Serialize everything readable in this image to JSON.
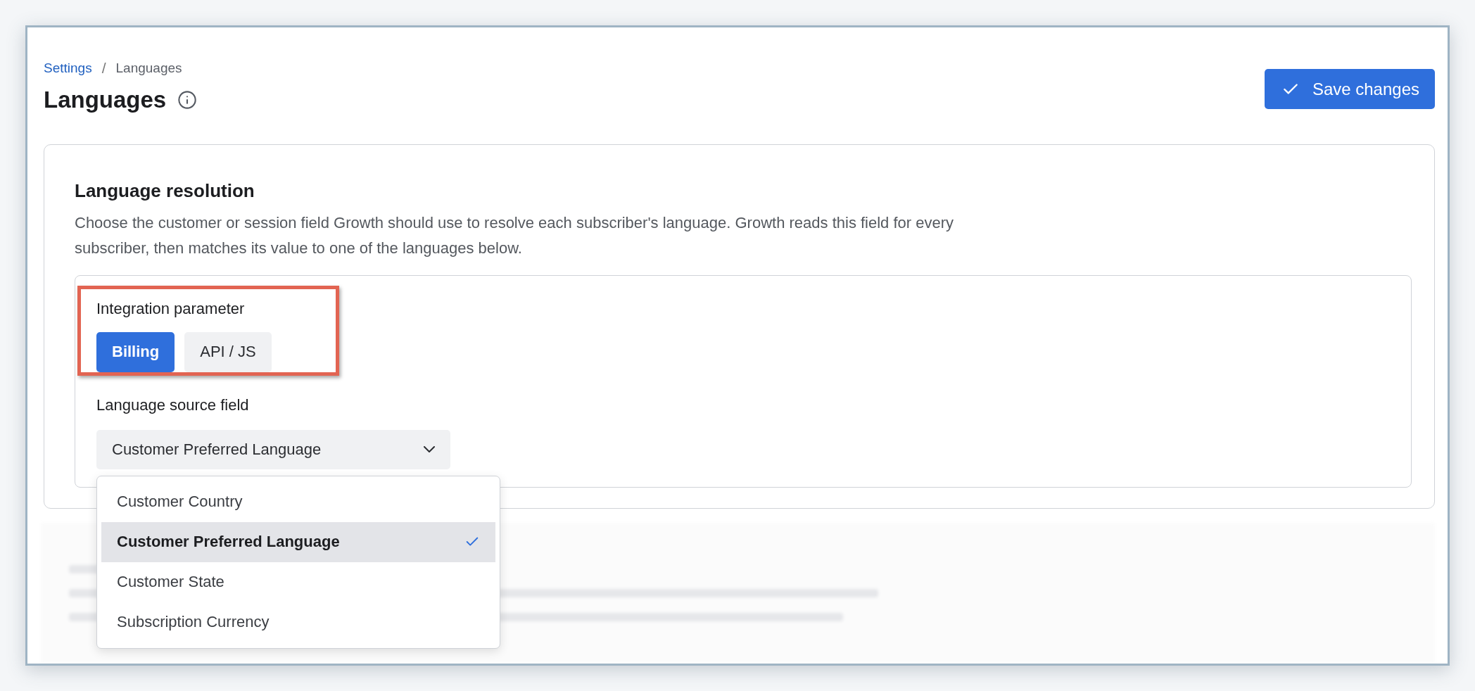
{
  "breadcrumb": {
    "items": [
      {
        "label": "Settings",
        "kind": "link"
      },
      {
        "label": "Languages",
        "kind": "current"
      }
    ],
    "separator": "/"
  },
  "title": "Languages",
  "save_button": {
    "label": "Save changes"
  },
  "section": {
    "title": "Language resolution",
    "description": "Choose the customer or session field Growth should use to resolve each subscriber's language. Growth reads this field for every subscriber, then matches its value to one of the languages below.",
    "integration_parameter": {
      "label": "Integration parameter",
      "options": [
        {
          "label": "Billing",
          "selected": true
        },
        {
          "label": "API / JS",
          "selected": false
        }
      ]
    },
    "language_source_field": {
      "label": "Language source field",
      "value": "Customer Preferred Language",
      "menu": [
        {
          "label": "Customer Country",
          "selected": false
        },
        {
          "label": "Customer Preferred Language",
          "selected": true
        },
        {
          "label": "Customer State",
          "selected": false
        },
        {
          "label": "Subscription Currency",
          "selected": false
        }
      ]
    }
  }
}
